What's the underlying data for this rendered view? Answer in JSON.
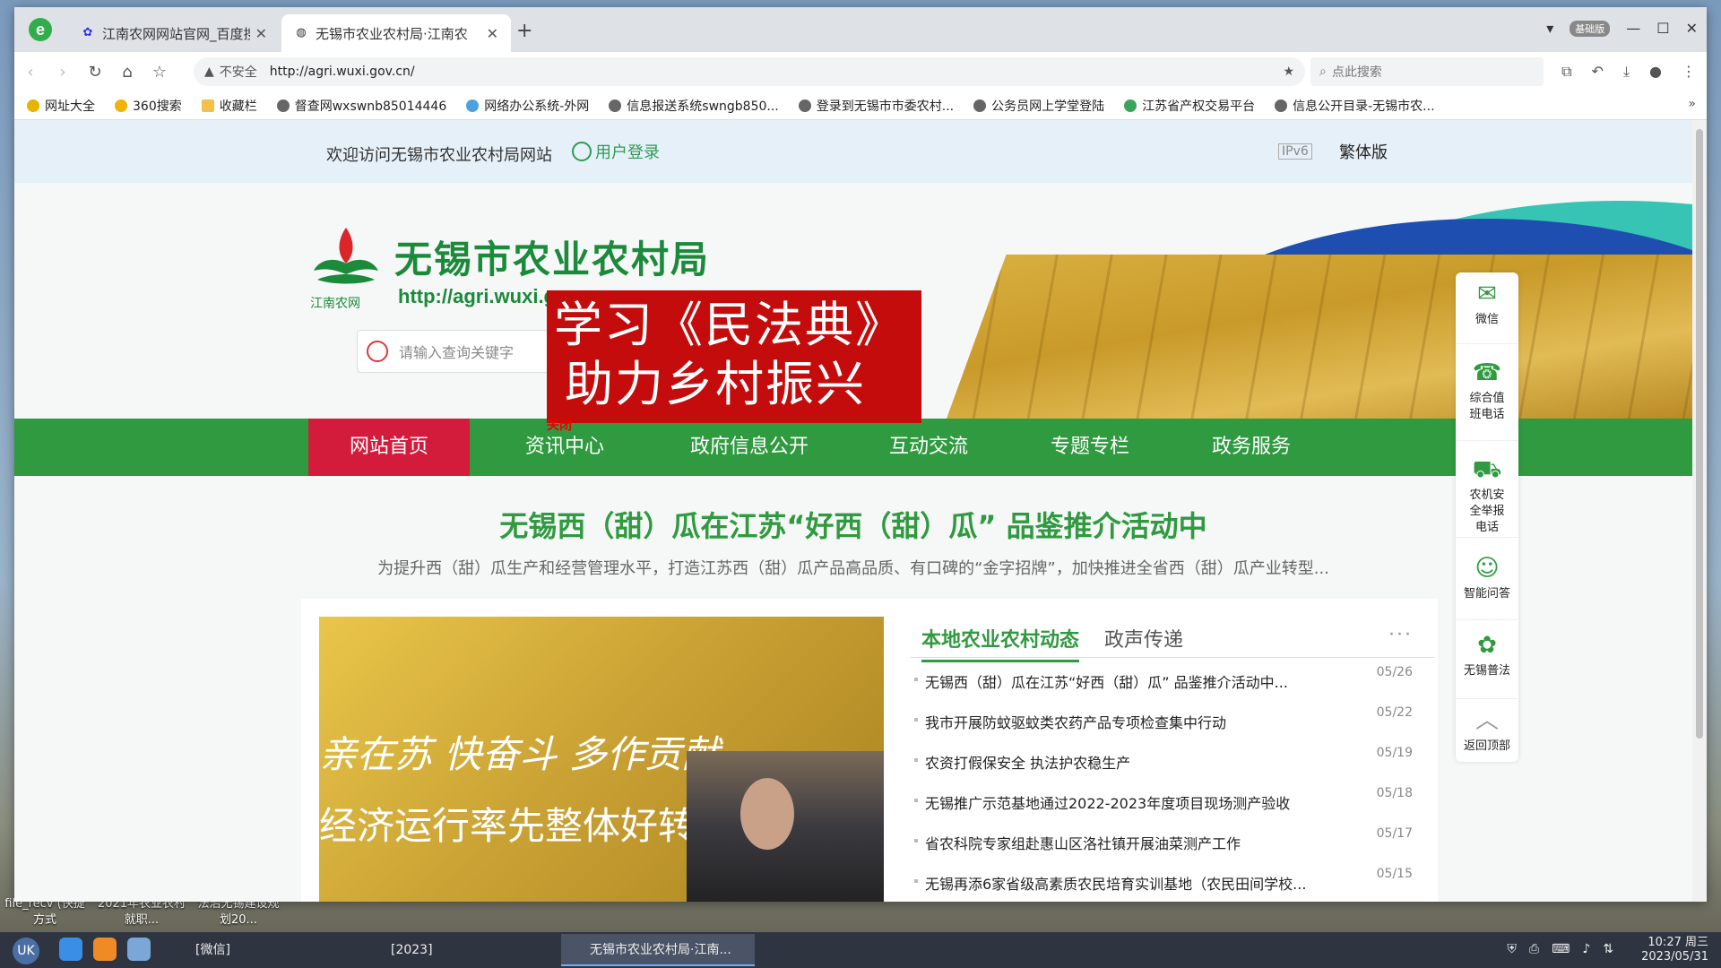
{
  "browser": {
    "tabs": [
      {
        "title": "江南农网网站官网_百度搜",
        "favicon": "baidu-paw-icon"
      },
      {
        "title": "无锡市农业农村局·江南农",
        "favicon": "globe-icon"
      }
    ],
    "edition_badge": "基础版",
    "url_warning": "不安全",
    "url": "http://agri.wuxi.gov.cn/",
    "search_placeholder": "点此搜索",
    "bookmarks": [
      "网址大全",
      "360搜索",
      "收藏栏",
      "督查网wxswnb85014446",
      "网络办公系统-外网",
      "信息报送系统swngb850...",
      "登录到无锡市市委农村...",
      "公务员网上学堂登陆",
      "江苏省产权交易平台",
      "信息公开目录-无锡市农..."
    ]
  },
  "site": {
    "welcome": "欢迎访问无锡市农业农村局网站",
    "login": "用户登录",
    "ipv6": "IPv6",
    "traditional": "繁体版",
    "title": "无锡市农业农村局",
    "url_text": "http://agri.wuxi.gov.cn",
    "logo_caption": "江南农网",
    "search_placeholder": "请输入查询关键字",
    "popup_line1": "学习《民法典》",
    "popup_line2": "助力乡村振兴",
    "popup_close": "关闭",
    "nav": [
      "网站首页",
      "资讯中心",
      "政府信息公开",
      "互动交流",
      "专题专栏",
      "政务服务"
    ],
    "headline": "无锡西（甜）瓜在江苏“好西（甜）瓜” 品鉴推介活动中",
    "headline_sub": "为提升西（甜）瓜生产和经营管理水平，打造江苏西（甜）瓜产品高品质、有口碑的“金字招牌”，加快推进全省西（甜）瓜产业转型...",
    "photo_text1": "亲在苏 快奋斗 多作贡献",
    "photo_text2": "经济运行率先整体好转",
    "news_tabs": [
      "本地农业农村动态",
      "政声传递"
    ],
    "more": "···",
    "news": [
      {
        "title": "无锡西（甜）瓜在江苏“好西（甜）瓜” 品鉴推介活动中...",
        "date": "05/26"
      },
      {
        "title": "我市开展防蚊驱蚊类农药产品专项检查集中行动",
        "date": "05/22"
      },
      {
        "title": "农资打假保安全 执法护农稳生产",
        "date": "05/19"
      },
      {
        "title": "无锡推广示范基地通过2022-2023年度项目现场测产验收",
        "date": "05/18"
      },
      {
        "title": "省农科院专家组赴惠山区洛社镇开展油菜测产工作",
        "date": "05/17"
      },
      {
        "title": "无锡再添6家省级高素质农民培育实训基地（农民田间学校...",
        "date": "05/15"
      }
    ],
    "float_menu": [
      {
        "label": "微信",
        "icon": "wechat-icon"
      },
      {
        "label": "综合值班电话",
        "icon": "phone-icon"
      },
      {
        "label": "农机安全举报电话",
        "icon": "tractor-icon"
      },
      {
        "label": "智能问答",
        "icon": "robot-icon"
      },
      {
        "label": "无锡普法",
        "icon": "law-icon"
      },
      {
        "label": "返回顶部",
        "icon": "arrow-up-icon"
      }
    ]
  },
  "desktop": {
    "icons": [
      "file_recv (快捷方式",
      "2021年农业农村就职...",
      "法治无锡建设规划20..."
    ]
  },
  "taskbar": {
    "tasks": [
      "[微信]",
      "[2023]",
      "无锡市农业农村局·江南..."
    ],
    "time": "10:27 周三",
    "date": "2023/05/31"
  }
}
